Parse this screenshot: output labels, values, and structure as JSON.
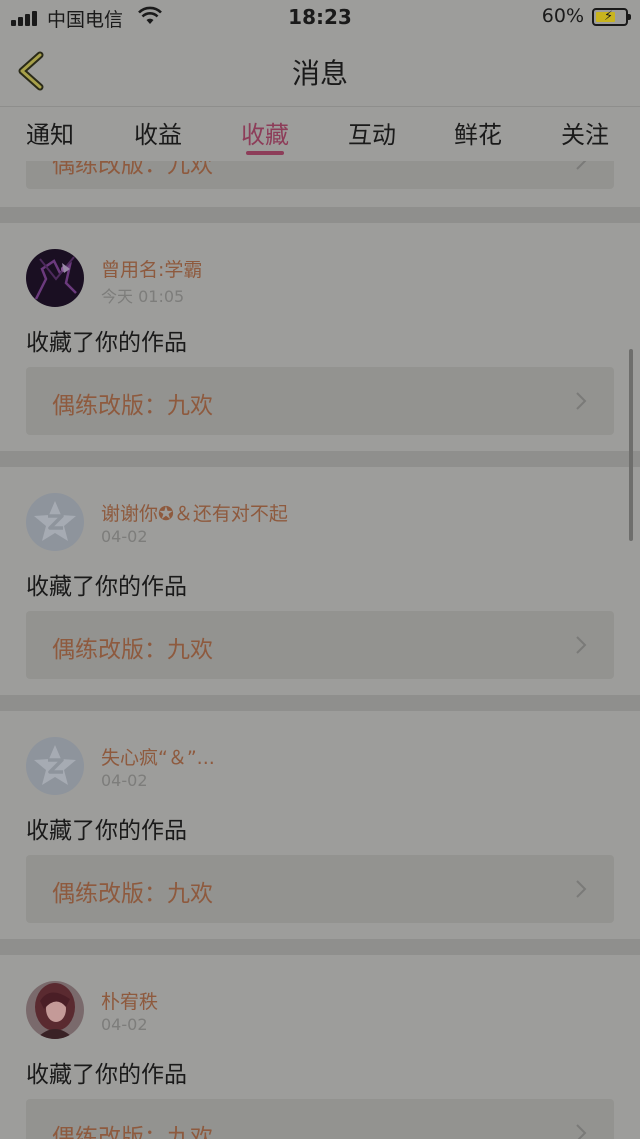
{
  "status_bar": {
    "carrier": "中国电信",
    "time": "18:23",
    "battery": "60%"
  },
  "nav": {
    "title": "消息"
  },
  "tabs": [
    {
      "label": "通知"
    },
    {
      "label": "收益"
    },
    {
      "label": "收藏",
      "active": true
    },
    {
      "label": "互动"
    },
    {
      "label": "鲜花"
    },
    {
      "label": "关注"
    }
  ],
  "top_partial_card": {
    "work_title": "偶练改版：九欢"
  },
  "notifications": [
    {
      "user": "曾用名:学霸",
      "date": "今天 01:05",
      "action": "收藏了你的作品",
      "work_title": "偶练改版：九欢",
      "avatar": "dark-purple-photo"
    },
    {
      "user": "谢谢你✪＆还有对不起",
      "date": "04-02",
      "action": "收藏了你的作品",
      "work_title": "偶练改版：九欢",
      "avatar": "default-qq-avatar"
    },
    {
      "user": "失心疯“＆”...",
      "date": "04-02",
      "action": "收藏了你的作品",
      "work_title": "偶练改版：九欢",
      "avatar": "default-qq-avatar"
    },
    {
      "user": "朴宥秩",
      "date": "04-02",
      "action": "收藏了你的作品",
      "work_title": "偶练改版：九欢",
      "avatar": "girl-photo"
    }
  ],
  "colors": {
    "accent": "#8d3d59",
    "username": "#8e5a3e"
  }
}
